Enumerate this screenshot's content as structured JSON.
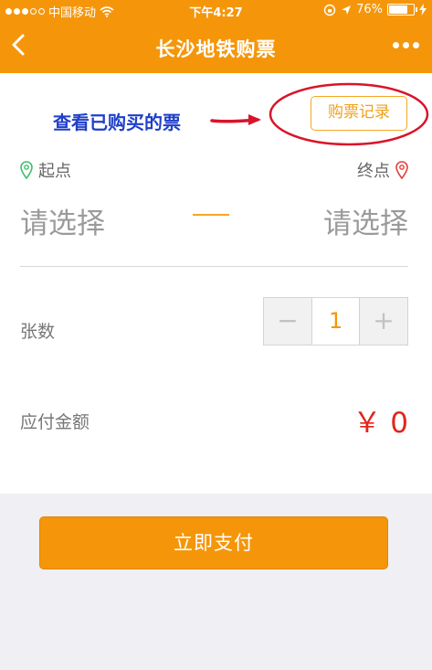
{
  "status_bar": {
    "carrier": "中国移动",
    "time": "下午4:27",
    "battery": "76%",
    "battery_level": 0.76
  },
  "nav": {
    "title": "长沙地铁购票"
  },
  "annotation": {
    "text": "查看已购买的票"
  },
  "records_button": {
    "label": "购票记录"
  },
  "route": {
    "from_label": "起点",
    "to_label": "终点",
    "from_value": "请选择",
    "to_value": "请选择"
  },
  "quantity": {
    "label": "张数",
    "value": "1",
    "minus": "−",
    "plus": "+"
  },
  "amount": {
    "label": "应付金额",
    "value": "￥ 0"
  },
  "pay_button": {
    "label": "立即支付"
  },
  "colors": {
    "brand": "#f5960a",
    "annotation": "#1f3fc8",
    "annotation_mark": "#d9142a",
    "price": "#e0251d"
  }
}
